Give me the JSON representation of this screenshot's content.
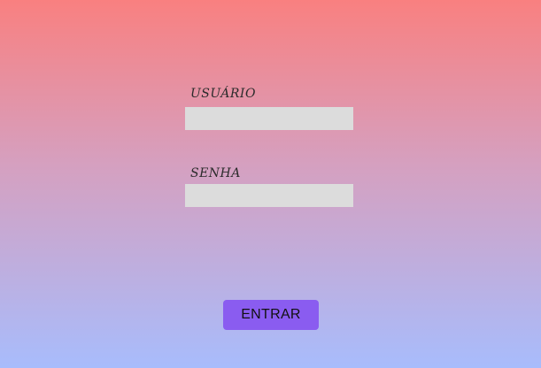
{
  "login_form": {
    "username_label": "USUÁRIO",
    "username_value": "",
    "password_label": "SENHA",
    "password_value": "",
    "submit_label": "ENTRAR"
  },
  "colors": {
    "background_top": "#f98080",
    "background_bottom": "#a8bcfc",
    "input_background": "#dcdcdc",
    "button_background": "#8a5cf0"
  }
}
